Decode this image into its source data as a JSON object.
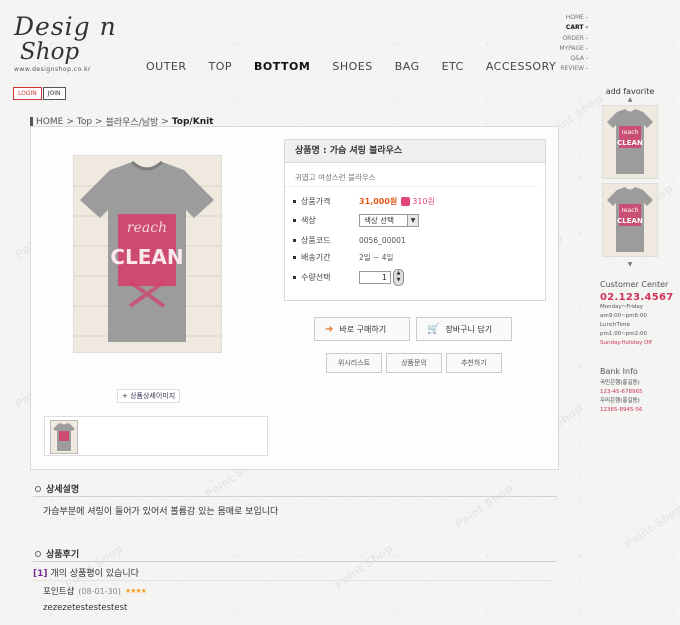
{
  "brand": {
    "logo_line1": "Desig n",
    "logo_line2": "Shop",
    "url": "www.designshop.co.kr"
  },
  "auth": {
    "login": "LOGIN",
    "join": "JOIN"
  },
  "nav": {
    "items": [
      {
        "label": "OUTER"
      },
      {
        "label": "TOP"
      },
      {
        "label": "BOTTOM"
      },
      {
        "label": "SHOES"
      },
      {
        "label": "BAG"
      },
      {
        "label": "ETC"
      },
      {
        "label": "ACCESSORY"
      }
    ],
    "active": "BOTTOM"
  },
  "util_menu": {
    "items": [
      {
        "label": "HOME  -"
      },
      {
        "label": "CART  -"
      },
      {
        "label": "ORDER  -"
      },
      {
        "label": "MYPAGE  -"
      },
      {
        "label": "Q&A  -"
      },
      {
        "label": "REVIEW  -"
      }
    ],
    "active": "CART  -"
  },
  "breadcrumb": {
    "items": [
      "HOME",
      "Top",
      "블라우스/남방",
      "Top/Knit"
    ],
    "separator": ">"
  },
  "product": {
    "name_label": "상품명 : 가슴 셔링 블라우스",
    "subtitle": "귀엽고 여성스런 블라우스",
    "price_label": "상품가격",
    "price": "31,000원",
    "points": "310원",
    "color_label": "색상",
    "color_select": "색상 선택",
    "code_label": "상품코드",
    "code": "0056_00001",
    "shipping_label": "배송기간",
    "shipping": "2일 ~ 4일",
    "qty_label": "수량선택",
    "qty": "1",
    "shirt_text": [
      "reach",
      "CLEAN"
    ]
  },
  "actions": {
    "buy_now": "바로 구매하기",
    "add_cart": "장바구니 담기",
    "wishlist": "위시리스트",
    "inquiry": "상품문의",
    "recommend": "추천하기",
    "detail_image": "+ 상품상세이미지"
  },
  "sidebar": {
    "favorite_title": "add favorite",
    "cs_title": "Customer Center",
    "cs_phone": "02.123.4567",
    "cs_lines": [
      "Monday~Friday",
      "am9:00~pm6:00",
      "LunchTime",
      "pm1:00~pm2:00"
    ],
    "cs_holiday": "Sunday.Holiday Off",
    "bank_title": "Bank Info",
    "bank1_name": "국민은행(홍길동)",
    "bank1_no": "123-45-678965",
    "bank2_name": "우리은행(홍길동)",
    "bank2_no": "12365-8945-56"
  },
  "sections": {
    "detail_title": "상세설명",
    "detail_text": "가슴부분에 셔링이 들어가 있어서 볼륨감 있는 몸매로 보입니다",
    "review_title": "상품후기",
    "review_count_num": "[1]",
    "review_count_text": "개의 상품평이 있습니다",
    "review_user": "포인트샵",
    "review_date": "(08-01-30)",
    "review_stars": "★★★★",
    "review_text": "zezezetestestestest"
  },
  "watermark": "Point Shop",
  "colors": {
    "accent": "#e0457c",
    "price": "#e25a1c",
    "shirt": "#9c9c9c",
    "shirt_print": "#d63c6a"
  }
}
